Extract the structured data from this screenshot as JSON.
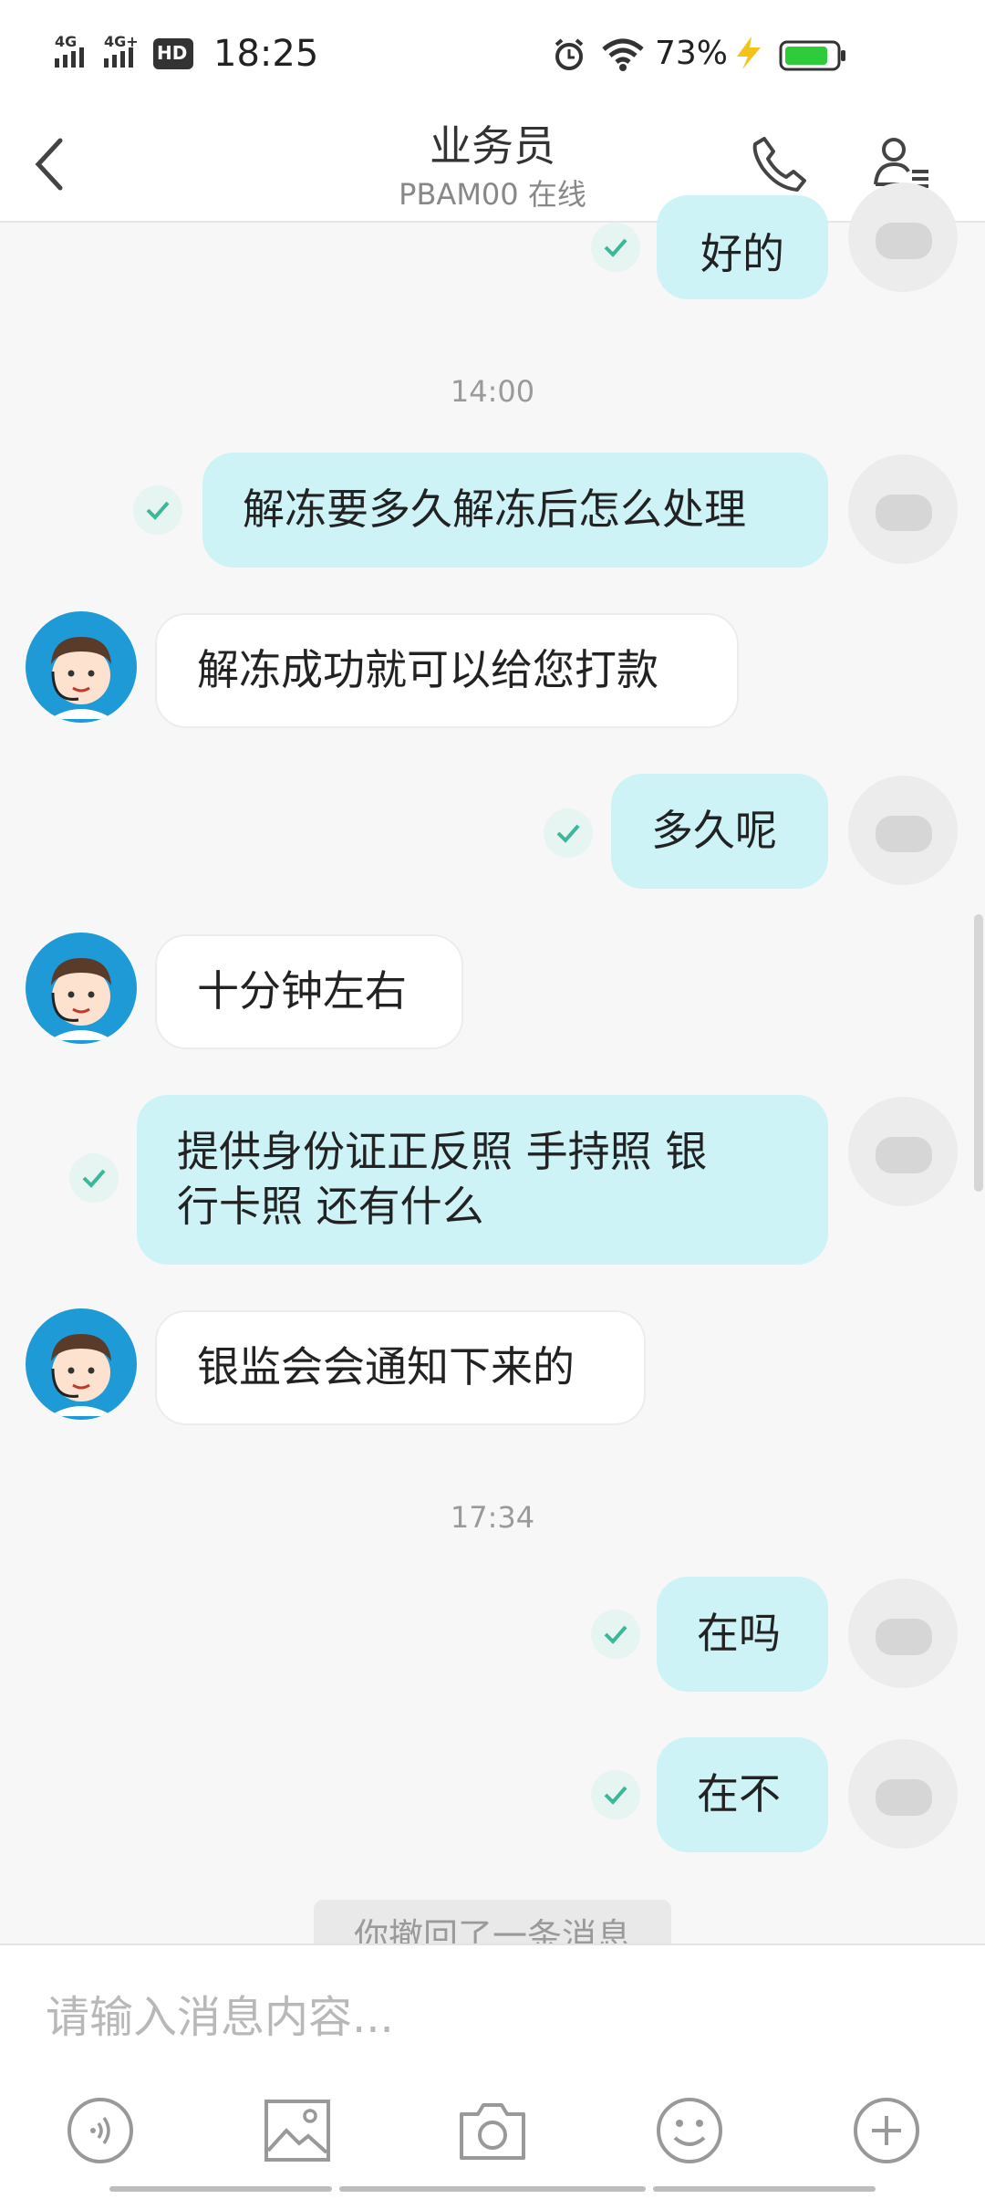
{
  "status_bar": {
    "signal1": "4G",
    "signal2": "4G+",
    "hd": "HD",
    "time": "18:25",
    "battery": "73%"
  },
  "header": {
    "title": "业务员",
    "subtitle": "PBAM00 在线"
  },
  "messages": {
    "m0": {
      "text": "好的"
    },
    "t1": "14:00",
    "m1": {
      "text": "解冻要多久解冻后怎么处理"
    },
    "m2": {
      "text": "解冻成功就可以给您打款"
    },
    "m3": {
      "text": "多久呢"
    },
    "m4": {
      "text": "十分钟左右"
    },
    "m5": {
      "line1": "提供身份证正反照 手持照 银",
      "line2": "行卡照 还有什么"
    },
    "m6": {
      "text": "银监会会通知下来的"
    },
    "t2": "17:34",
    "m7": {
      "text": "在吗"
    },
    "m8": {
      "text": "在不"
    },
    "recall": "你撤回了一条消息"
  },
  "input": {
    "placeholder": "请输入消息内容..."
  },
  "avatars": {
    "self_logo": "mi"
  },
  "colors": {
    "outgoing_bubble": "#cdf3f7",
    "check": "#3bb89a",
    "agent_avatar_bg": "#1e9ad6"
  }
}
